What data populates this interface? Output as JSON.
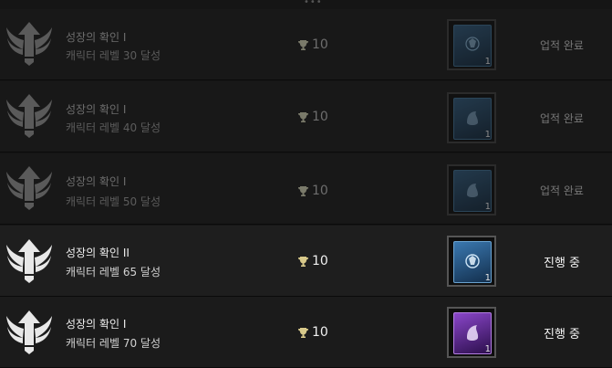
{
  "achievements": [
    {
      "title": "성장의 확인 I",
      "subtitle": "캐릭터 레벨 30 달성",
      "points": "10",
      "reward_qty": "1",
      "status": "업적 완료",
      "state": "completed",
      "card_color": "#1d3d5a"
    },
    {
      "title": "성장의 확인 I",
      "subtitle": "캐릭터 레벨 40 달성",
      "points": "10",
      "reward_qty": "1",
      "status": "업적 완료",
      "state": "completed",
      "card_color": "#1d3d5a"
    },
    {
      "title": "성장의 확인 I",
      "subtitle": "캐릭터 레벨 50 달성",
      "points": "10",
      "reward_qty": "1",
      "status": "업적 완료",
      "state": "completed",
      "card_color": "#1d3d5a"
    },
    {
      "title": "성장의 확인 II",
      "subtitle": "캐릭터 레벨 65 달성",
      "points": "10",
      "reward_qty": "1",
      "status": "진행 중",
      "state": "in-progress",
      "card_color": "#1f4d7a"
    },
    {
      "title": "성장의 확인 I",
      "subtitle": "캐릭터 레벨 70 달성",
      "points": "10",
      "reward_qty": "1",
      "status": "진행 중",
      "state": "in-progress",
      "card_color": "#5a2a8a"
    }
  ],
  "icons": {
    "emblem": "winged-arrow-icon",
    "points": "trophy-icon",
    "reward": "reward-card-icon"
  }
}
